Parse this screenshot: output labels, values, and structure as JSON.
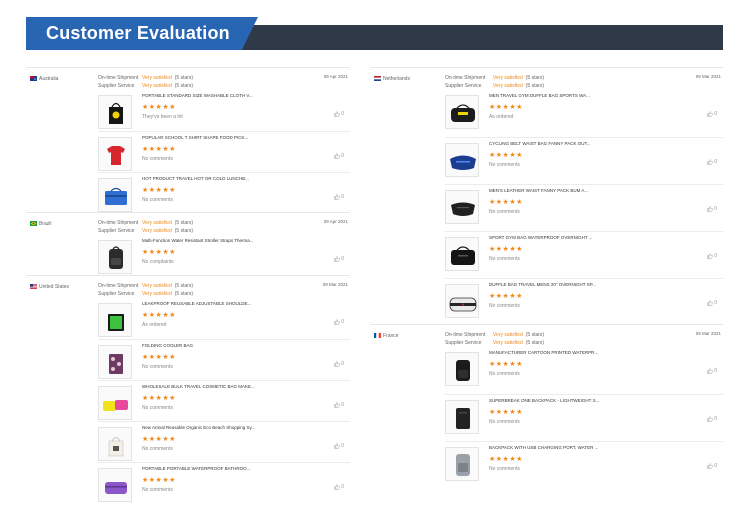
{
  "banner": {
    "title": "Customer Evaluation"
  },
  "labels": {
    "shipment": "On-time Shipment",
    "service": "Supplier Service"
  },
  "left_reviews": [
    {
      "country": "Australia",
      "flag": "australia-flag-icon",
      "shipment": "Very satisfied",
      "shipment_stars": "(5 stars)",
      "service": "Very satisfied",
      "service_stars": "(5 stars)",
      "date": "09 Apr 2021",
      "items": [
        {
          "name": "PORTABLE STANDARD SIZE WASHABLE CLOTH V...",
          "stars": "★★★★★",
          "comment": "They've been a hit",
          "likes": "0",
          "icon": "tote-bag-icon"
        },
        {
          "name": "POPULAR SCHOOL T SHIRT SHAPE FOOD PICK...",
          "stars": "★★★★★",
          "comment": "No comments",
          "likes": "0",
          "icon": "tshirt-bag-icon"
        },
        {
          "name": "HOT PRODUCT TRAVEL HOT OR COLD LUNCHB...",
          "stars": "★★★★★",
          "comment": "No comments",
          "likes": "0",
          "icon": "cooler-bag-icon"
        }
      ]
    },
    {
      "country": "Brazil",
      "flag": "brazil-flag-icon",
      "shipment": "Very satisfied",
      "shipment_stars": "(5 stars)",
      "service": "Very satisfied",
      "service_stars": "(5 stars)",
      "date": "09 Apr 2021",
      "items": [
        {
          "name": "Multi-Function Water Resistant Stroller Straps Therma...",
          "stars": "★★★★★",
          "comment": "No complaints",
          "likes": "0",
          "icon": "diaper-backpack-icon"
        }
      ]
    },
    {
      "country": "United States",
      "flag": "usa-flag-icon",
      "shipment": "Very satisfied",
      "shipment_stars": "(5 stars)",
      "service": "Very satisfied",
      "service_stars": "(5 stars)",
      "date": "09 Mar 2021",
      "items": [
        {
          "name": "LEAKPROOF REUSABLE ADJUSTABLE SHOULDE...",
          "stars": "★★★★★",
          "comment": "As ordered",
          "likes": "0",
          "icon": "green-cooler-bag-icon"
        },
        {
          "name": "FOLDING COOLER BAG",
          "stars": "★★★★★",
          "comment": "No comments",
          "likes": "0",
          "icon": "floral-cooler-bag-icon"
        },
        {
          "name": "WHOLESALE BULK TRAVEL COSMETIC BAG MAKE...",
          "stars": "★★★★★",
          "comment": "No comments",
          "likes": "0",
          "icon": "cosmetic-bag-icon"
        },
        {
          "name": "New Arrival Reusable Organic Eco Beach Shopping Sy...",
          "stars": "★★★★★",
          "comment": "No comments",
          "likes": "0",
          "icon": "canvas-tote-icon"
        },
        {
          "name": "PORTABLE PORTABLE WATERPROOF BATHROO...",
          "stars": "★★★★★",
          "comment": "No comments",
          "likes": "0",
          "icon": "toiletry-bag-icon"
        }
      ]
    }
  ],
  "right_reviews": [
    {
      "country": "Netherlands",
      "flag": "netherlands-flag-icon",
      "shipment": "Very satisfied",
      "shipment_stars": "(5 stars)",
      "service": "Very satisfied",
      "service_stars": "(5 stars)",
      "date": "09 Mar 2021",
      "items": [
        {
          "name": "MEN TRAVEL GYM DUFFLE BAG SPORTS WA...",
          "stars": "★★★★★",
          "comment": "As ordered",
          "likes": "0",
          "icon": "duffle-bag-icon"
        },
        {
          "name": "CYCLING BELT WAIST BAG FANNY PACK OUT...",
          "stars": "★★★★★",
          "comment": "No comments",
          "likes": "0",
          "icon": "waist-bag-icon"
        },
        {
          "name": "MEN'S LEATHER WAIST FANNY PACK BUM A...",
          "stars": "★★★★★",
          "comment": "No comments",
          "likes": "0",
          "icon": "leather-fanny-pack-icon"
        },
        {
          "name": "SPORT GYM BAG WATERPROOF OVERNIGHT ...",
          "stars": "★★★★★",
          "comment": "No comments",
          "likes": "0",
          "icon": "gym-bag-icon"
        },
        {
          "name": "DUFFLE BAG TRAVEL MENS 20\" OVERNIGHT SP...",
          "stars": "★★★★★",
          "comment": "No comments",
          "likes": "0",
          "icon": "travel-duffle-icon"
        }
      ]
    },
    {
      "country": "France",
      "flag": "france-flag-icon",
      "shipment": "Very satisfied",
      "shipment_stars": "(5 stars)",
      "service": "Very satisfied",
      "service_stars": "(5 stars)",
      "date": "09 Mar 2021",
      "items": [
        {
          "name": "MANUFACTURER CARTOON PRINTED WATERPR...",
          "stars": "★★★★★",
          "comment": "No comments",
          "likes": "0",
          "icon": "black-backpack-icon"
        },
        {
          "name": "SUPERBREAK ONE BACKPACK - LIGHTWEIGHT S...",
          "stars": "★★★★★",
          "comment": "No comments",
          "likes": "0",
          "icon": "laptop-backpack-icon"
        },
        {
          "name": "BACKPACK WITH USB CHARGING PORT, WATER ...",
          "stars": "★★★★★",
          "comment": "No comments",
          "likes": "0",
          "icon": "usb-backpack-icon"
        }
      ]
    }
  ]
}
